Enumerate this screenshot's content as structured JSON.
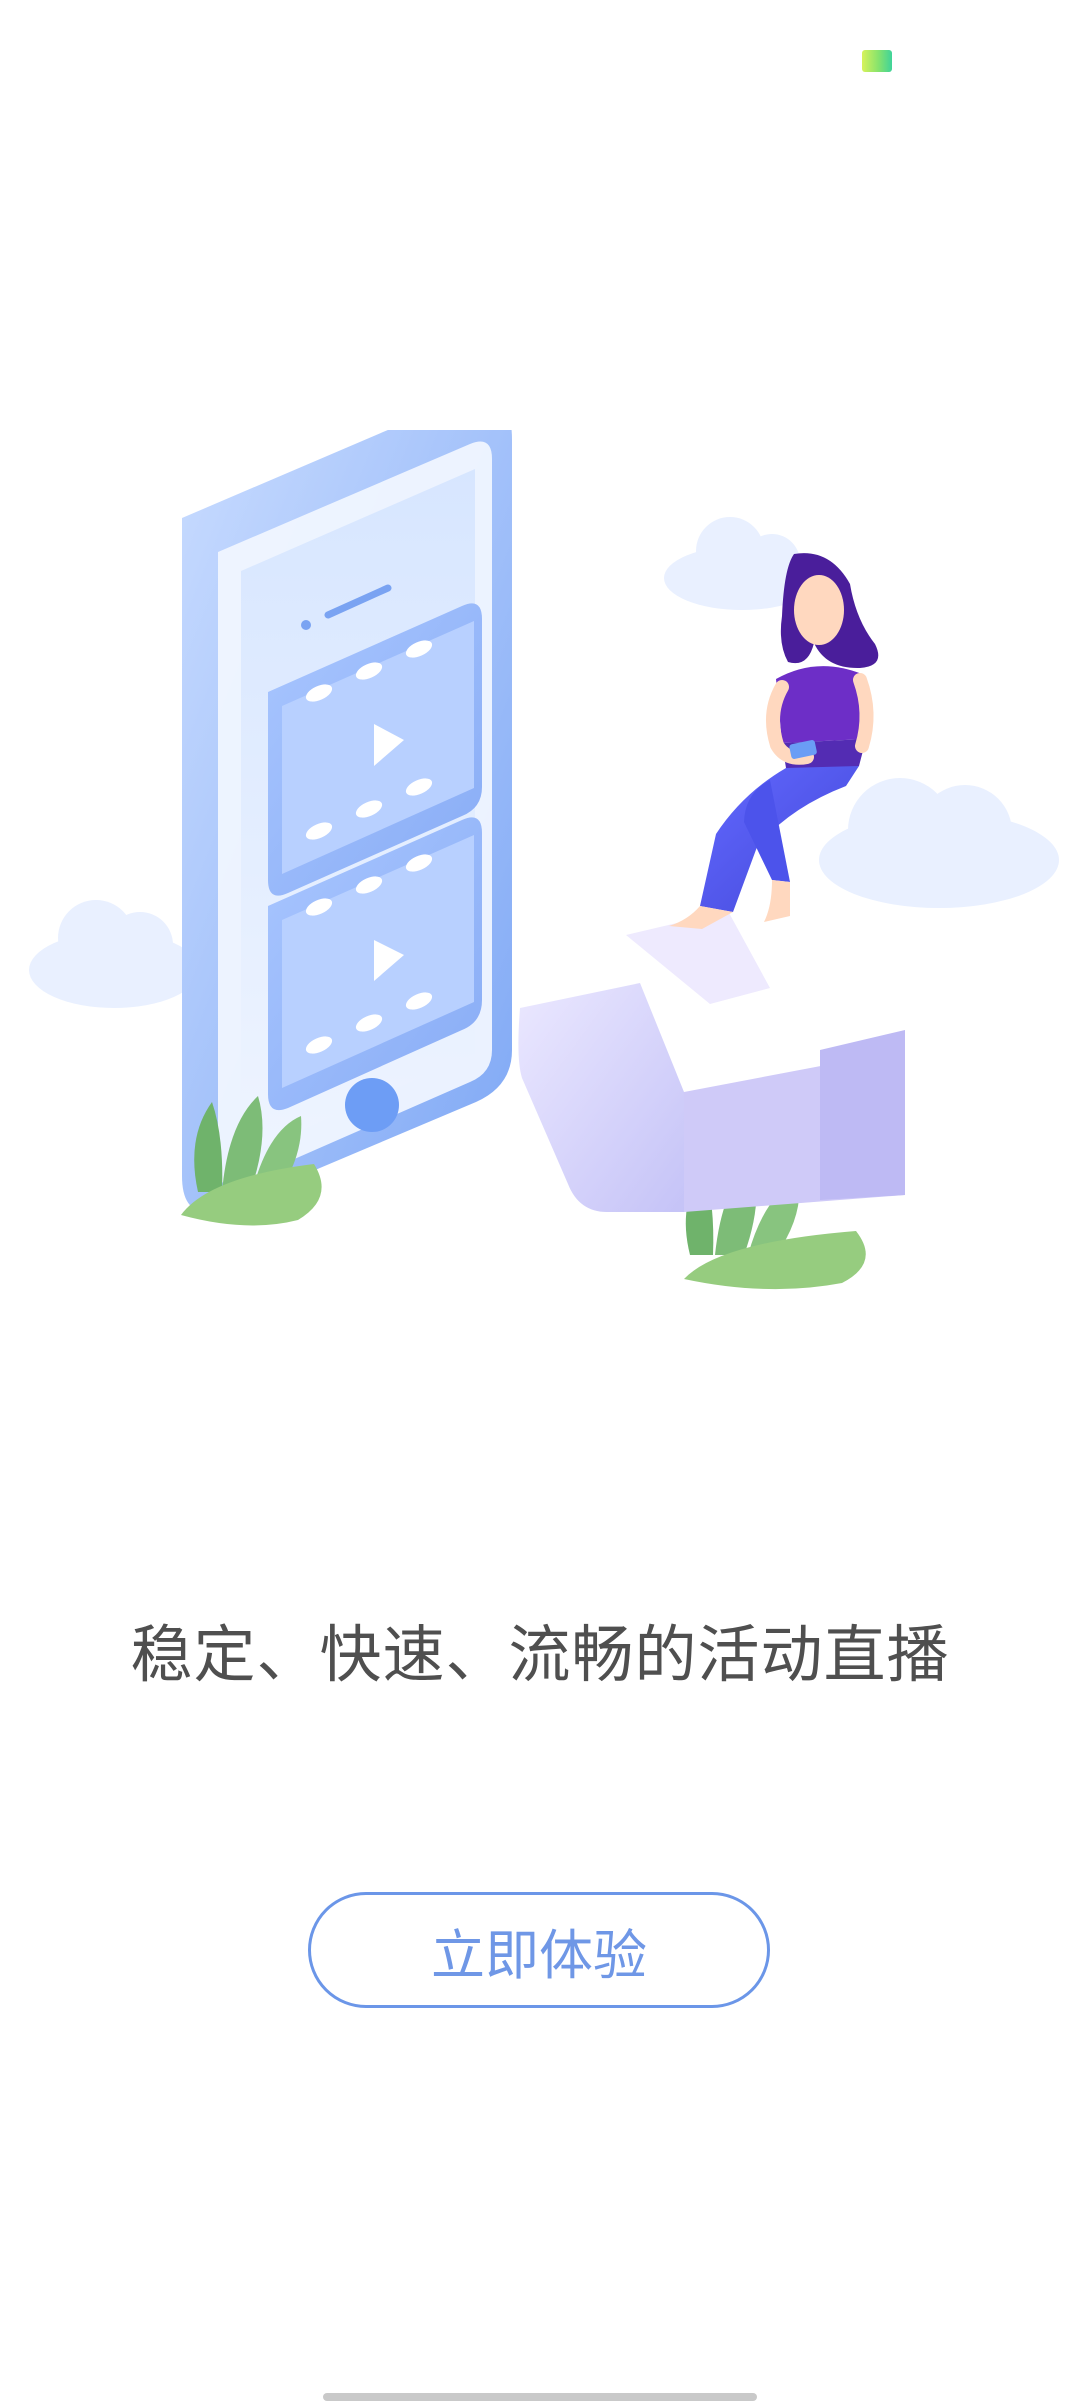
{
  "status": {
    "badge_icon": "color-badge-icon"
  },
  "onboarding": {
    "tagline": "稳定、快速、流畅的活动直播",
    "cta_label": "立即体验"
  },
  "illustration": {
    "icon": "phone-video-illustration"
  },
  "colors": {
    "accent": "#6b96e8",
    "text": "#4f4f4f",
    "phone_blue": "#8db3f6",
    "plant_green": "#78b86e"
  }
}
